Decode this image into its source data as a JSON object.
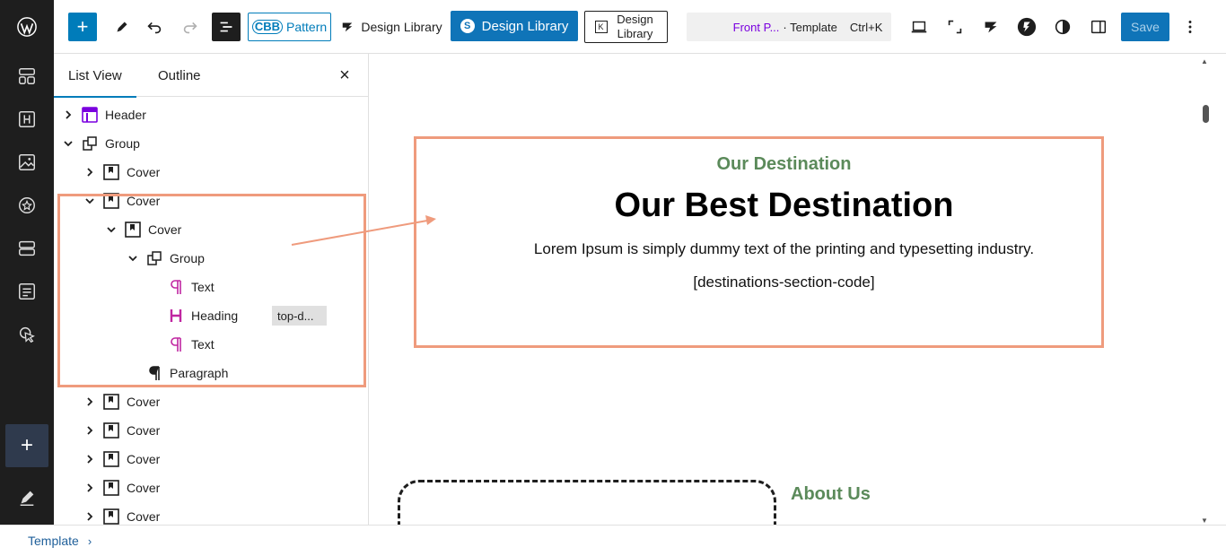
{
  "toolbar": {
    "pattern_badge": "CBB",
    "pattern_label": "Pattern",
    "design_library_1": "Design Library",
    "design_library_2": "Design Library",
    "design_library_3": "Design Library",
    "doc_title": "Front P...",
    "doc_type": "· Template",
    "shortcut": "Ctrl+K",
    "save_label": "Save"
  },
  "panel": {
    "tab_list": "List View",
    "tab_outline": "Outline",
    "close": "×",
    "rows": [
      {
        "label": "Header"
      },
      {
        "label": "Group"
      },
      {
        "label": "Cover"
      },
      {
        "label": "Cover"
      },
      {
        "label": "Cover"
      },
      {
        "label": "Group"
      },
      {
        "label": "Text"
      },
      {
        "label": "Heading",
        "badge": "top-d..."
      },
      {
        "label": "Text"
      },
      {
        "label": "Paragraph"
      },
      {
        "label": "Cover"
      },
      {
        "label": "Cover"
      },
      {
        "label": "Cover"
      },
      {
        "label": "Cover"
      },
      {
        "label": "Cover"
      }
    ]
  },
  "canvas": {
    "subtitle": "Our Destination",
    "title": "Our Best Destination",
    "body": "Lorem Ipsum is simply dummy text of the printing and typesetting industry.",
    "shortcode": "[destinations-section-code]",
    "about": "About Us"
  },
  "footer": {
    "breadcrumb": "Template"
  },
  "colors": {
    "accent": "#007cba",
    "highlight": "#ef9b7d",
    "green_heading": "#5b8a5a",
    "block_icon_purple": "#7a00df",
    "block_icon_pink": "#c026a1"
  }
}
